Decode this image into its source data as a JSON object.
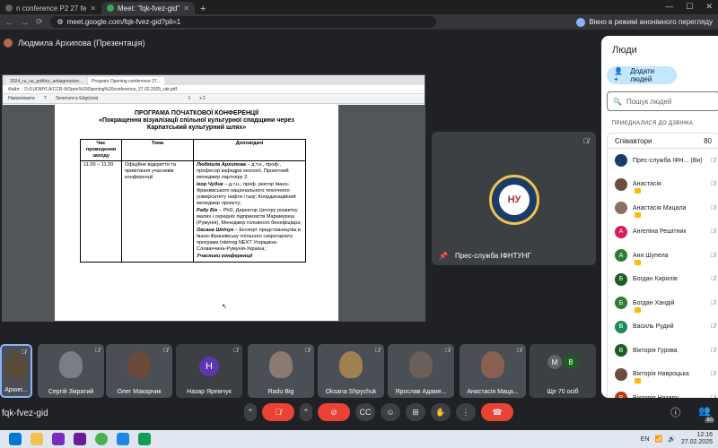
{
  "browser": {
    "tabs": [
      {
        "label": "n conference P2 27 fe",
        "active": false
      },
      {
        "label": "Meet: \"fqk-fvez-gid\"",
        "active": true
      }
    ],
    "new_tab": "+",
    "url": "meet.google.com/fqk-fvez-gid?pli=1",
    "profile_label": "Вікно в режимі анонімного перегляду",
    "window_controls": [
      "—",
      "☐",
      "✕"
    ]
  },
  "presenter": {
    "label": "Людмила Архипова (Презентація)"
  },
  "shared_screen": {
    "tabs": [
      "2024_ru_ua_politics_antiagressive...",
      "Program Opening conference 27..."
    ],
    "address": "D:/LUDMYLA/CCR-9/Open%20Opening%20conference_27.02.2025_ukr.pdf",
    "file_label": "Файл",
    "toolbar": [
      "Намалювати",
      "Т",
      "Зачитати в Edge(ом)",
      "1",
      "з 2"
    ],
    "title_line1": "ПРОГРАМА ПОЧАТКОВОЇ КОНФЕРЕНЦІЇ",
    "title_line2": "«Покращення візуалізації спільної культурної спадщини через",
    "title_line3": "Карпатський культурний шлях»",
    "table": {
      "headers": [
        "Час проведення заходу",
        "Тема",
        "Доповідачі"
      ],
      "time": "11.00 – 11.20",
      "topic": "Офіційне відкриття та привітання учасників конференції",
      "speakers": [
        {
          "name": "Людмила Архипова",
          "desc": " – д.т.н., проф., професор кафедри екології, Проектний менеджер партнеру 2;"
        },
        {
          "name": "Ігор Чудик",
          "desc": " – д.т.н., проф. ректор Івано-Франківського національного технічного університету нафти і газу; Координаційний менеджер проекту;"
        },
        {
          "name": "Раду Біг",
          "desc": " – PhD, Директор Центру розвитку малих і середніх підприємств Марамуреш (Румунія), Менеджер головного бенефіціара;"
        },
        {
          "name": "Оксана Шпічук",
          "desc": " – Експерт представництва в Івано-Франківську спільного секретаріату програми Interreg NEXT Угорщина-Словаччина-Румунія-Україна;"
        },
        {
          "name": "Учасники конференції",
          "desc": ""
        }
      ]
    }
  },
  "big_tile": {
    "name": "Прес-служба ІФНТУНГ",
    "logo_text": "НУ"
  },
  "filmstrip": [
    {
      "name": "Архип...",
      "kind": "video",
      "color": "#5a4a3a"
    },
    {
      "name": "Сергій Зікратий",
      "kind": "video",
      "color": "#7a7d84"
    },
    {
      "name": "Олег Макарчик",
      "kind": "video",
      "color": "#6a4a3a"
    },
    {
      "name": "Назар Яремчук",
      "kind": "letter",
      "letter": "Н",
      "color": "#5e35b1"
    },
    {
      "name": "Radu Big",
      "kind": "video",
      "color": "#8a7a70"
    },
    {
      "name": "Oksana Shpychuk",
      "kind": "video",
      "color": "#a08050"
    },
    {
      "name": "Ярослав Адаме...",
      "kind": "video",
      "color": "#6a6058"
    },
    {
      "name": "Анастасія Маца...",
      "kind": "video",
      "color": "#8a6050"
    },
    {
      "name": "Ще 70 осіб",
      "kind": "more",
      "letters": [
        "M",
        "B"
      ]
    }
  ],
  "meeting_code": "fqk-fvez-gid",
  "controls": {
    "icons": [
      "chevron-up",
      "mic-off",
      "chevron-up",
      "camera-off",
      "captions",
      "emoji",
      "present",
      "raise-hand",
      "more",
      "end-call"
    ],
    "right_icons": [
      "info",
      "people"
    ],
    "people_badge": "80"
  },
  "panel": {
    "title": "Люди",
    "add_label": "Додати людей",
    "search_placeholder": "Пошук людей",
    "section_label": "ПРИЄДНАЛИСЯ ДО ДЗВІНКА",
    "cohost_label": "Співавтори",
    "cohost_count": "80",
    "people": [
      {
        "name": "Прес-служба ІФН... (Ви)",
        "color": "#1a3c6b",
        "letter": "",
        "hand": false
      },
      {
        "name": "Анастасія",
        "color": "#6d4c41",
        "letter": "",
        "hand": true
      },
      {
        "name": "Анастасія Мацала",
        "color": "#8d6e63",
        "letter": "",
        "hand": true
      },
      {
        "name": "Ангеліна Решітник",
        "color": "#d81b60",
        "letter": "А",
        "hand": false
      },
      {
        "name": "Аня Шупела",
        "color": "#2e7d32",
        "letter": "А",
        "hand": true
      },
      {
        "name": "Богдан Кирилів",
        "color": "#1b5e20",
        "letter": "Б",
        "hand": false
      },
      {
        "name": "Богдан Хандій",
        "color": "#2e7d32",
        "letter": "Б",
        "hand": true
      },
      {
        "name": "Василь Рудий",
        "color": "#1b8a5a",
        "letter": "В",
        "hand": false
      },
      {
        "name": "Вікторія Гурова",
        "color": "#1b5e20",
        "letter": "В",
        "hand": false
      },
      {
        "name": "Вікторія Навроцька",
        "color": "#6d4c41",
        "letter": "",
        "hand": true
      },
      {
        "name": "Вікторія Назару...",
        "color": "#bf360c",
        "letter": "В",
        "hand": false
      }
    ]
  },
  "taskbar": {
    "lang": "EN",
    "time": "12:16",
    "date": "27.02.2025"
  }
}
